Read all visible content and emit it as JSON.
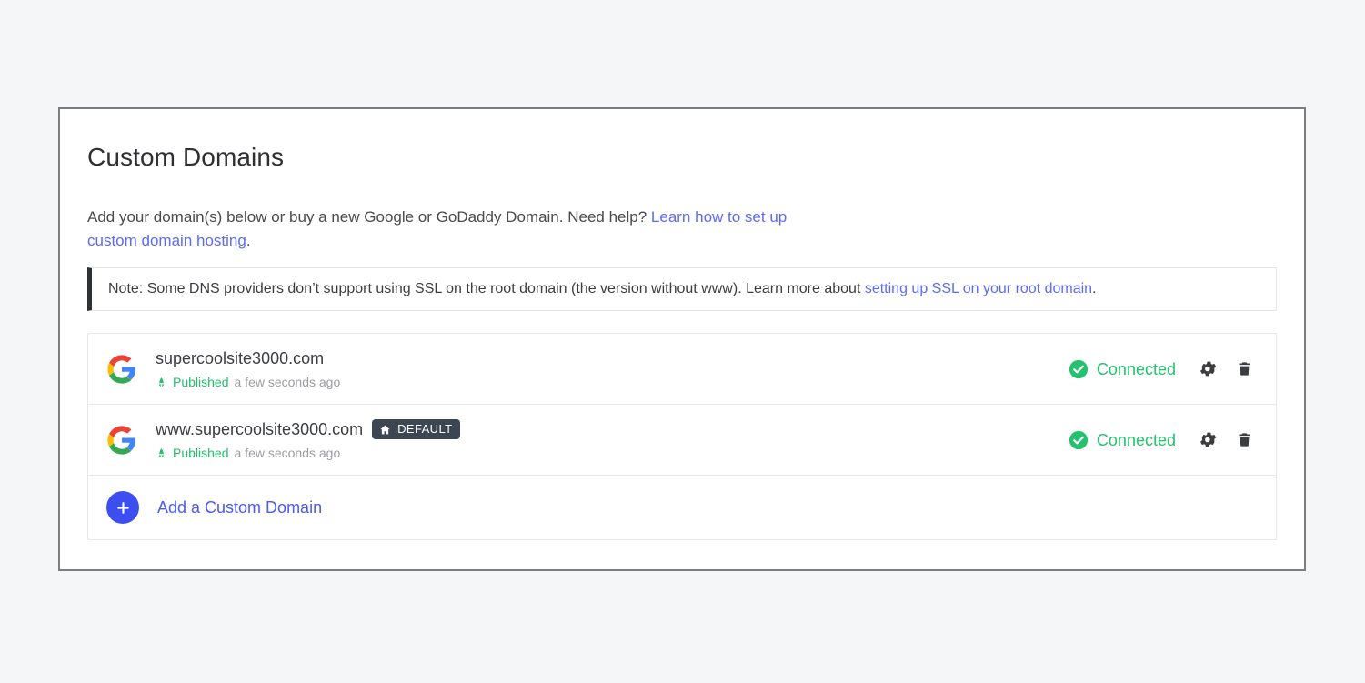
{
  "card": {
    "title": "Custom Domains",
    "description": {
      "lead": "Add your domain(s) below or buy a new Google or GoDaddy Domain. Need help? ",
      "link_text": "Learn how to set up custom domain hosting",
      "trailing": "."
    },
    "note": {
      "prefix": "Note: Some DNS providers don’t support using SSL on the root domain (the version without www). Learn more about ",
      "link_text": "setting up SSL on your root domain",
      "suffix": "."
    }
  },
  "domains": [
    {
      "provider_icon": "google-logo-icon",
      "name": "supercoolsite3000.com",
      "is_default": false,
      "default_badge_label": "DEFAULT",
      "publish_state": "Published",
      "publish_time": "a few seconds ago",
      "connection_status": "Connected",
      "settings_icon": "gear-icon",
      "delete_icon": "trash-icon"
    },
    {
      "provider_icon": "google-logo-icon",
      "name": "www.supercoolsite3000.com",
      "is_default": true,
      "default_badge_label": "DEFAULT",
      "publish_state": "Published",
      "publish_time": "a few seconds ago",
      "connection_status": "Connected",
      "settings_icon": "gear-icon",
      "delete_icon": "trash-icon"
    }
  ],
  "add_domain": {
    "icon": "plus-icon",
    "label": "Add a Custom Domain"
  },
  "colors": {
    "page_background": "#f4f6f8",
    "card_border": "#7d7d7d",
    "link": "#5c6bf5",
    "accent_blue": "#3d4ef0",
    "status_green": "#24c26f",
    "published_green": "#1fc16b",
    "badge_dark": "#3c4552",
    "note_bar": "#2e3135"
  }
}
